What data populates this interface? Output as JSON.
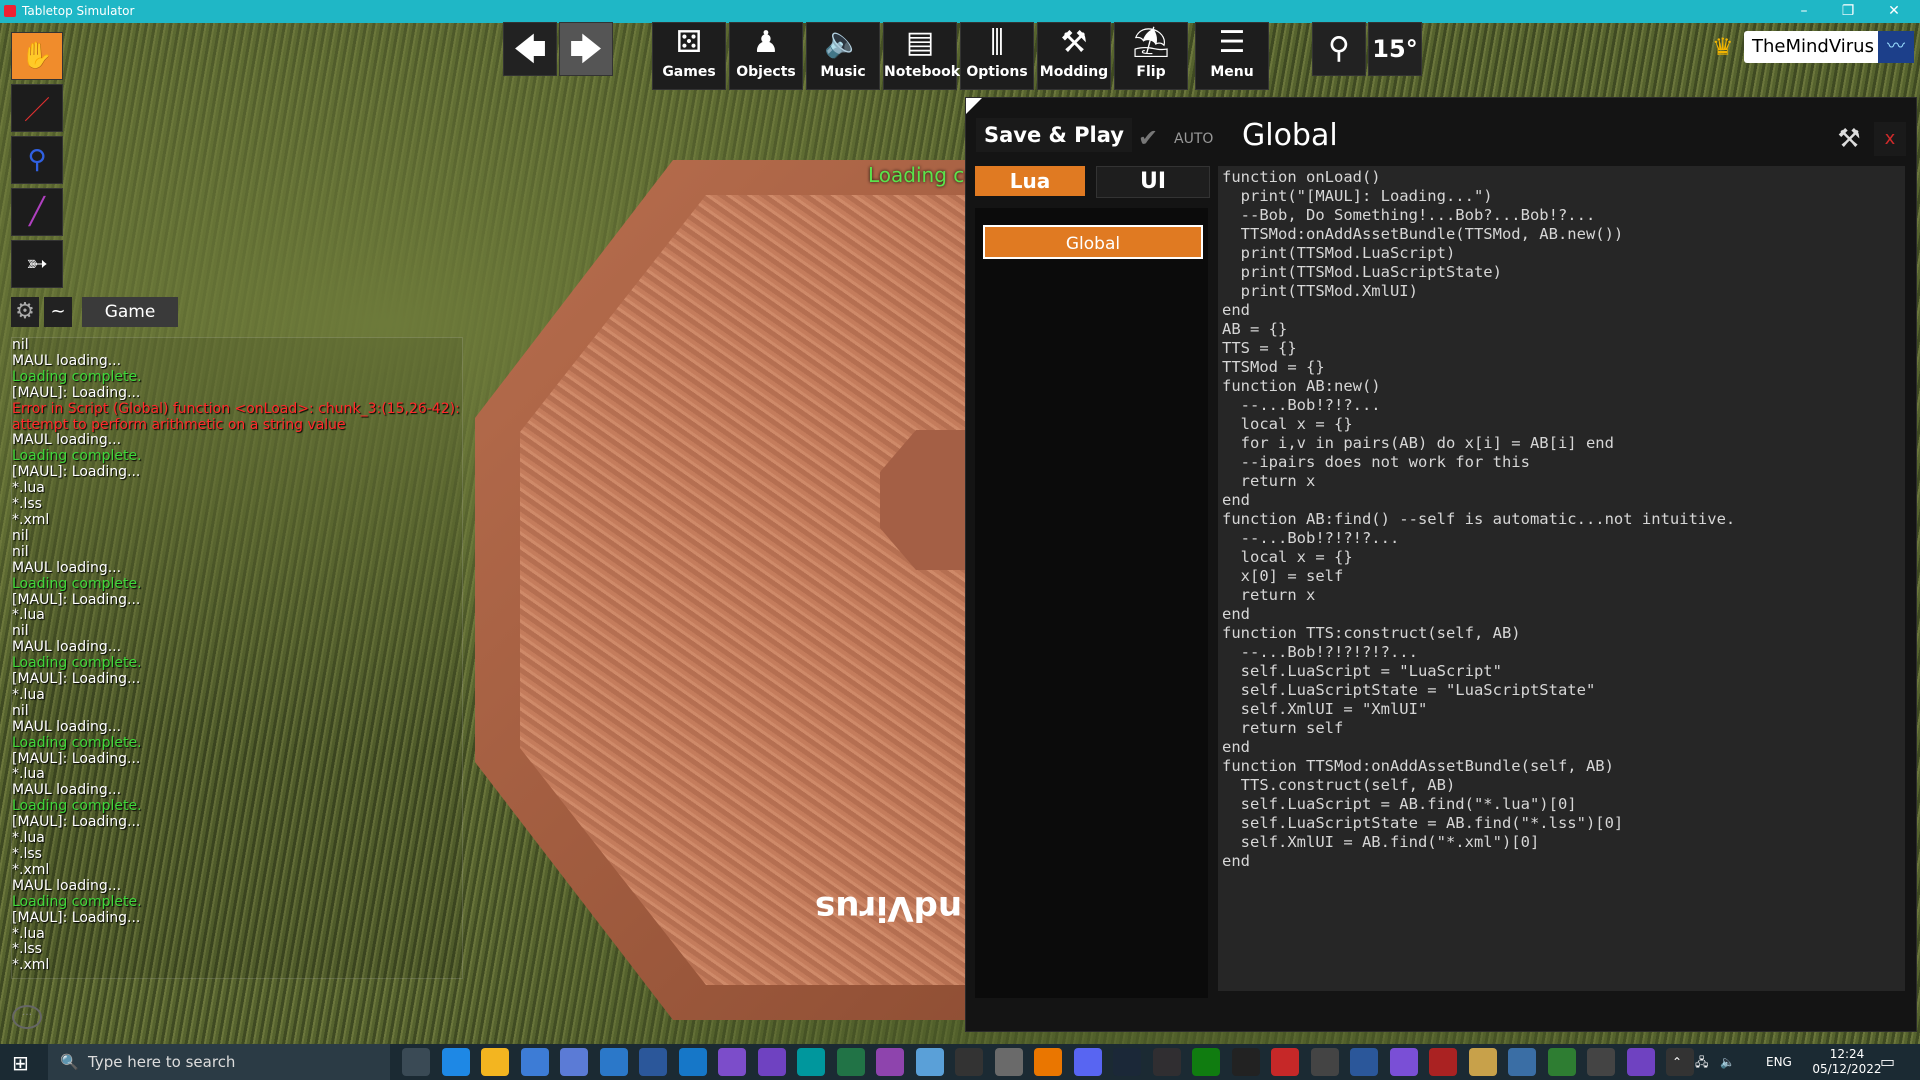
{
  "window": {
    "title": "Tabletop Simulator",
    "controls": {
      "minimize": "–",
      "restore": "❐",
      "close": "✕"
    }
  },
  "scene": {
    "loading_banner": "Loading complete.",
    "table_label": "ndVirus"
  },
  "left_tools": [
    "hand-icon",
    "pen-icon",
    "zoom-icon",
    "line-icon",
    "gizmo-icon"
  ],
  "chat": {
    "gear": "⚙",
    "tilde": "~",
    "active_tab": "Game",
    "lines": [
      {
        "text": "nil",
        "color": "white"
      },
      {
        "text": "MAUL loading...",
        "color": "white"
      },
      {
        "text": "Loading complete.",
        "color": "green"
      },
      {
        "text": "[MAUL]: Loading...",
        "color": "white"
      },
      {
        "text": "Error in Script (Global) function <onLoad>: chunk_3:(15,26-42):",
        "color": "red"
      },
      {
        "text": "attempt to perform arithmetic on a string value",
        "color": "red"
      },
      {
        "text": "MAUL loading...",
        "color": "white"
      },
      {
        "text": "Loading complete.",
        "color": "green"
      },
      {
        "text": "[MAUL]: Loading...",
        "color": "white"
      },
      {
        "text": "*.lua",
        "color": "white"
      },
      {
        "text": "*.lss",
        "color": "white"
      },
      {
        "text": "*.xml",
        "color": "white"
      },
      {
        "text": "nil",
        "color": "white"
      },
      {
        "text": "nil",
        "color": "white"
      },
      {
        "text": "MAUL loading...",
        "color": "white"
      },
      {
        "text": "Loading complete.",
        "color": "green"
      },
      {
        "text": "[MAUL]: Loading...",
        "color": "white"
      },
      {
        "text": "*.lua",
        "color": "white"
      },
      {
        "text": "nil",
        "color": "white"
      },
      {
        "text": "MAUL loading...",
        "color": "white"
      },
      {
        "text": "Loading complete.",
        "color": "green"
      },
      {
        "text": "[MAUL]: Loading...",
        "color": "white"
      },
      {
        "text": "*.lua",
        "color": "white"
      },
      {
        "text": "nil",
        "color": "white"
      },
      {
        "text": "MAUL loading...",
        "color": "white"
      },
      {
        "text": "Loading complete.",
        "color": "green"
      },
      {
        "text": "[MAUL]: Loading...",
        "color": "white"
      },
      {
        "text": "*.lua",
        "color": "white"
      },
      {
        "text": "MAUL loading...",
        "color": "white"
      },
      {
        "text": "Loading complete.",
        "color": "green"
      },
      {
        "text": "[MAUL]: Loading...",
        "color": "white"
      },
      {
        "text": "*.lua",
        "color": "white"
      },
      {
        "text": "*.lss",
        "color": "white"
      },
      {
        "text": "*.xml",
        "color": "white"
      },
      {
        "text": "MAUL loading...",
        "color": "white"
      },
      {
        "text": "Loading complete.",
        "color": "green"
      },
      {
        "text": "[MAUL]: Loading...",
        "color": "white"
      },
      {
        "text": "*.lua",
        "color": "white"
      },
      {
        "text": "*.lss",
        "color": "white"
      },
      {
        "text": "*.xml",
        "color": "white"
      }
    ]
  },
  "toolbar": {
    "back_icon": "🡄",
    "forward_icon": "🡆",
    "buttons": [
      {
        "label": "Games",
        "icon": "dice-icon",
        "glyph": "⚄"
      },
      {
        "label": "Objects",
        "icon": "pawn-icon",
        "glyph": "♟"
      },
      {
        "label": "Music",
        "icon": "speaker-icon",
        "glyph": "🔈"
      },
      {
        "label": "Notebook",
        "icon": "notebook-icon",
        "glyph": "▤"
      },
      {
        "label": "Options",
        "icon": "sliders-icon",
        "glyph": "⫼"
      },
      {
        "label": "Modding",
        "icon": "tools-icon",
        "glyph": "⚒"
      },
      {
        "label": "Flip",
        "icon": "flip-icon",
        "glyph": "⛱"
      },
      {
        "label": "Menu",
        "icon": "menu-icon",
        "glyph": "☰"
      }
    ],
    "stick_icon": "⚲",
    "rotation": "15°",
    "user": "TheMindVirus",
    "crown": "♛",
    "voice": "〰"
  },
  "editor": {
    "save_play": "Save & Play",
    "auto_label": "AUTO",
    "auto_check": "✔",
    "title": "Global",
    "wrench": "⚒",
    "close": "x",
    "tabs": {
      "lua": "Lua",
      "ui": "UI"
    },
    "scripts": [
      "Global"
    ],
    "code": [
      "function onLoad()",
      "  print(\"[MAUL]: Loading...\")",
      "  --Bob, Do Something!...Bob?...Bob!?...",
      "  TTSMod:onAddAssetBundle(TTSMod, AB.new())",
      "  print(TTSMod.LuaScript)",
      "  print(TTSMod.LuaScriptState)",
      "  print(TTSMod.XmlUI)",
      "end",
      "",
      "AB = {}",
      "TTS = {}",
      "TTSMod = {}",
      "",
      "function AB:new()",
      "  --...Bob!?!?...",
      "  local x = {}",
      "  for i,v in pairs(AB) do x[i] = AB[i] end",
      "  --ipairs does not work for this",
      "  return x",
      "end",
      "",
      "function AB:find() --self is automatic...not intuitive.",
      "  --...Bob!?!?!?...",
      "  local x = {}",
      "  x[0] = self",
      "  return x",
      "end",
      "",
      "function TTS:construct(self, AB)",
      "  --...Bob!?!?!?!?...",
      "  self.LuaScript = \"LuaScript\"",
      "  self.LuaScriptState = \"LuaScriptState\"",
      "  self.XmlUI = \"XmlUI\"",
      "  return self",
      "end",
      "",
      "function TTSMod:onAddAssetBundle(self, AB)",
      "  TTS.construct(self, AB)",
      "  self.LuaScript = AB.find(\"*.lua\")[0]",
      "  self.LuaScriptState = AB.find(\"*.lss\")[0]",
      "  self.XmlUI = AB.find(\"*.xml\")[0]",
      "end"
    ]
  },
  "taskbar": {
    "search_placeholder": "Type here to search",
    "search_icon": "🔍",
    "start_icon": "⊞",
    "apps": [
      "task-view-icon",
      "edge-icon",
      "explorer-icon",
      "store-icon",
      "mail-icon",
      "photos-icon",
      "word-icon",
      "vscode-icon",
      "visual-studio-icon",
      "github-icon",
      "arduino-icon",
      "excel-icon",
      "app-icon",
      "notepad-icon",
      "terminal-icon",
      "print-icon",
      "blender-icon",
      "discord-icon",
      "steam-icon",
      "obs-icon",
      "xbox-icon",
      "unity-icon",
      "tts-icon",
      "app2-icon",
      "word2-icon",
      "app3-icon",
      "app4-icon",
      "app5-icon",
      "app6-icon",
      "app7-icon",
      "app8-icon",
      "vs-icon",
      "app9-icon"
    ],
    "tray": {
      "lang": "ENG",
      "time": "12:24",
      "date": "05/12/2022"
    }
  }
}
